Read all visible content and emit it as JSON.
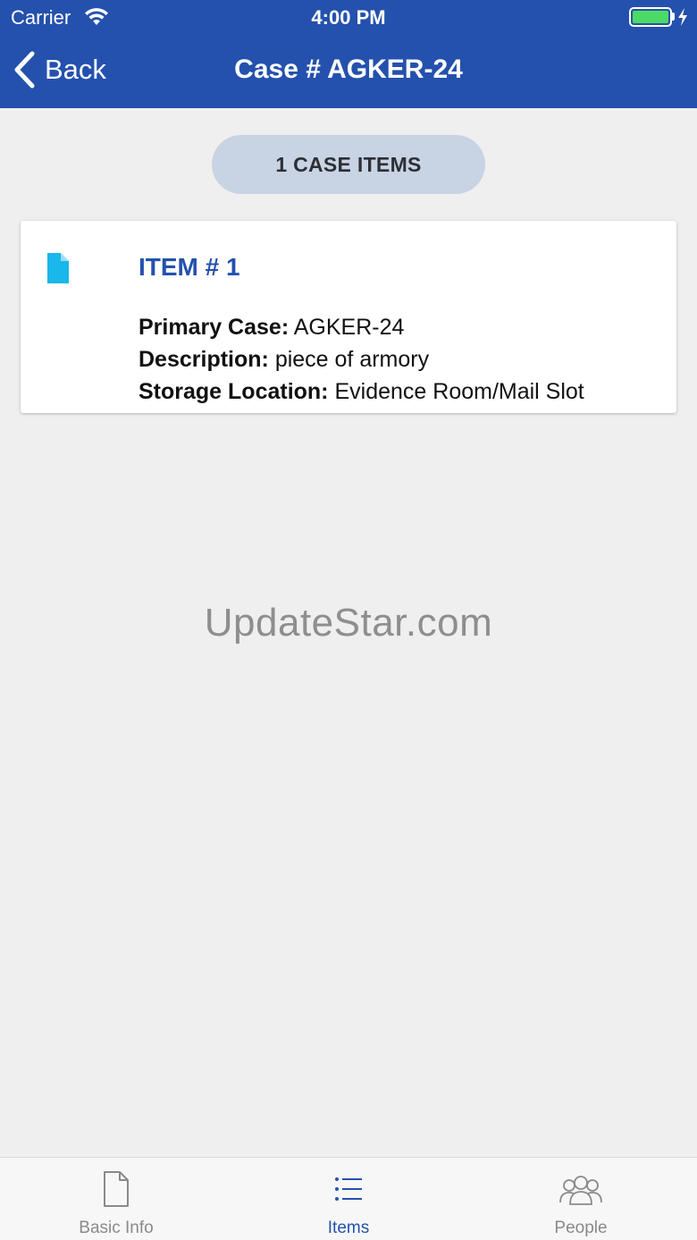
{
  "status_bar": {
    "carrier": "Carrier",
    "time": "4:00 PM",
    "battery_color": "#4cd964"
  },
  "nav": {
    "back_label": "Back",
    "title": "Case # AGKER-24"
  },
  "items_count_label": "1 CASE ITEMS",
  "items": [
    {
      "title": "ITEM # 1",
      "icon": "document-icon",
      "fields": [
        {
          "label": "Primary Case:",
          "value": "AGKER-24"
        },
        {
          "label": "Description:",
          "value": "piece of armory"
        },
        {
          "label": "Storage Location:",
          "value": "Evidence Room/Mail Slot"
        }
      ]
    }
  ],
  "watermark": "UpdateStar.com",
  "tabs": [
    {
      "label": "Basic Info",
      "icon": "document-outline-icon",
      "active": false
    },
    {
      "label": "Items",
      "icon": "list-icon",
      "active": true
    },
    {
      "label": "People",
      "icon": "people-icon",
      "active": false
    }
  ],
  "colors": {
    "brand": "#2451ad",
    "accent_icon": "#1ab7ea",
    "pill": "#c8d3e3",
    "background": "#efefef"
  }
}
